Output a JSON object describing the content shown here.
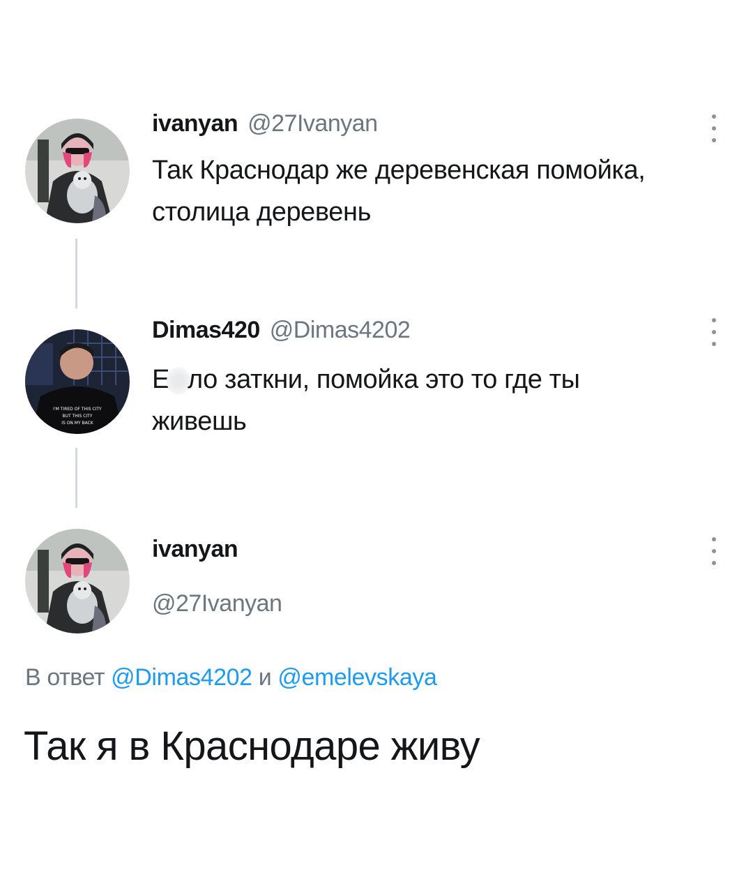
{
  "tweets": [
    {
      "name": "ivanyan",
      "handle": "@27Ivanyan",
      "text": "Так Краснодар же деревенская помойка, столица деревень"
    },
    {
      "name": "Dimas420",
      "handle": "@Dimas4202",
      "text_start": "Е",
      "text_rest": "ло заткни, помойка это то где ты живешь"
    }
  ],
  "main_tweet": {
    "name": "ivanyan",
    "handle": "@27Ivanyan",
    "reply_prefix": "В ответ",
    "reply_mention_1": "@Dimas4202",
    "reply_joiner": "и",
    "reply_mention_2": "@emelevskaya",
    "text": "Так я в Краснодаре живу"
  },
  "avatar2_shirt_text": "I'M TIRED OF THIS CITY BUT THIS CITY IS ON MY BACK",
  "colors": {
    "link": "#1d9bf0",
    "secondary_text": "#6b7680",
    "thread_line": "#cfd9de"
  },
  "icons": [
    "more-vertical-icon"
  ]
}
